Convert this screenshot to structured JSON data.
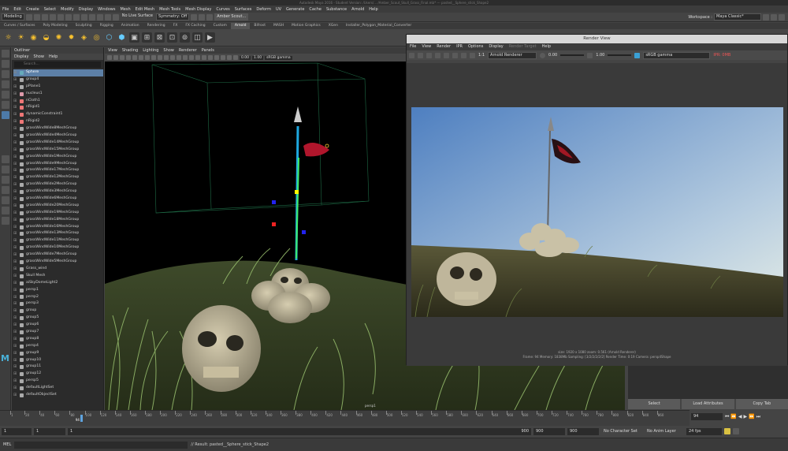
{
  "titlebar": {
    "text": "Autodesk Maya 2016 - Student Version: /Users/... /Amber_Scout_Skull_Grass_Final.mb* --- pasted__Sphere_stick_Shape2"
  },
  "menubar": [
    "File",
    "Edit",
    "Create",
    "Select",
    "Modify",
    "Display",
    "Windows",
    "Mesh",
    "Edit Mesh",
    "Mesh Tools",
    "Mesh Display",
    "Curves",
    "Surfaces",
    "Deform",
    "UV",
    "Generate",
    "Cache",
    "Substance",
    "Arnold",
    "Help"
  ],
  "status": {
    "mode": "Modeling",
    "live": "No Live Surface",
    "symmetry": "Symmetry: Off",
    "user": "Amber Scout...",
    "workspace_label": "Workspace :",
    "workspace": "Maya Classic*"
  },
  "shelf_tabs": [
    "Curves / Surfaces",
    "Poly Modeling",
    "Sculpting",
    "Rigging",
    "Animation",
    "Rendering",
    "FX",
    "FX Caching",
    "Custom",
    "Arnold",
    "Bifrost",
    "MASH",
    "Motion Graphics",
    "XGen",
    "Installer_Polygon_Material_Converter"
  ],
  "shelf_active": "Arnold",
  "outliner": {
    "title": "Outliner",
    "menu": [
      "Display",
      "Show",
      "Help"
    ],
    "search": "Search...",
    "items": [
      {
        "label": "Sphere",
        "selected": true,
        "color": "#6ab"
      },
      {
        "label": "group4",
        "color": "#aaa"
      },
      {
        "label": "pPlane1",
        "color": "#aaa"
      },
      {
        "label": "nucleus1",
        "color": "#d9a"
      },
      {
        "label": "nCloth1",
        "color": "#e77"
      },
      {
        "label": "nRigid1",
        "color": "#e77"
      },
      {
        "label": "dynamicConstraint1",
        "color": "#e77"
      },
      {
        "label": "nRigid2",
        "color": "#e77"
      },
      {
        "label": "grassWindWide8MeshGroup",
        "color": "#aaa"
      },
      {
        "label": "grassWindWide4MeshGroup",
        "color": "#aaa"
      },
      {
        "label": "grassWindWide14MeshGroup",
        "color": "#aaa"
      },
      {
        "label": "grassWindWide15MeshGroup",
        "color": "#aaa"
      },
      {
        "label": "grassWindWide1MeshGroup",
        "color": "#aaa"
      },
      {
        "label": "grassWindWide9MeshGroup",
        "color": "#aaa"
      },
      {
        "label": "grassWindWide17MeshGroup",
        "color": "#aaa"
      },
      {
        "label": "grassWindWide12MeshGroup",
        "color": "#aaa"
      },
      {
        "label": "grassWindWide2MeshGroup",
        "color": "#aaa"
      },
      {
        "label": "grassWindWide3MeshGroup",
        "color": "#aaa"
      },
      {
        "label": "grassWindWide6MeshGroup",
        "color": "#aaa"
      },
      {
        "label": "grassWindWide20MeshGroup",
        "color": "#aaa"
      },
      {
        "label": "grassWindWide19MeshGroup",
        "color": "#aaa"
      },
      {
        "label": "grassWindWide18MeshGroup",
        "color": "#aaa"
      },
      {
        "label": "grassWindWide16MeshGroup",
        "color": "#aaa"
      },
      {
        "label": "grassWindWide13MeshGroup",
        "color": "#aaa"
      },
      {
        "label": "grassWindWide11MeshGroup",
        "color": "#aaa"
      },
      {
        "label": "grassWindWide10MeshGroup",
        "color": "#aaa"
      },
      {
        "label": "grassWindWide7MeshGroup",
        "color": "#aaa"
      },
      {
        "label": "grassWindWide5MeshGroup",
        "color": "#aaa"
      },
      {
        "label": "Grass_wind",
        "color": "#aaa"
      },
      {
        "label": "Skull Mesh",
        "color": "#aaa"
      },
      {
        "label": "aiSkyDomeLight2",
        "color": "#aaa"
      },
      {
        "label": "persp1",
        "color": "#aaa"
      },
      {
        "label": "persp2",
        "color": "#aaa"
      },
      {
        "label": "persp3",
        "color": "#aaa"
      },
      {
        "label": "group",
        "color": "#aaa"
      },
      {
        "label": "group5",
        "color": "#aaa"
      },
      {
        "label": "group6",
        "color": "#aaa"
      },
      {
        "label": "group7",
        "color": "#aaa"
      },
      {
        "label": "group8",
        "color": "#aaa"
      },
      {
        "label": "persp4",
        "color": "#aaa"
      },
      {
        "label": "group9",
        "color": "#aaa"
      },
      {
        "label": "group10",
        "color": "#aaa"
      },
      {
        "label": "group11",
        "color": "#aaa"
      },
      {
        "label": "group12",
        "color": "#aaa"
      },
      {
        "label": "persp5",
        "color": "#aaa"
      },
      {
        "label": "defaultLightSet",
        "color": "#aaa"
      },
      {
        "label": "defaultObjectSet",
        "color": "#aaa"
      }
    ]
  },
  "viewport": {
    "menu": [
      "View",
      "Shading",
      "Lighting",
      "Show",
      "Renderer",
      "Panels"
    ],
    "near": "0.00",
    "far": "1.00",
    "colorspace": "sRGB gamma",
    "camera": "persp1"
  },
  "render_view": {
    "title": "Render View",
    "menu": [
      "File",
      "View",
      "Render",
      "IPR",
      "Options",
      "Display",
      "Render Target",
      "Help"
    ],
    "ratio": "1:1",
    "renderer": "Arnold Renderer",
    "exposure": "0.00",
    "gamma": "1.00",
    "colorspace": "sRGB gamma",
    "ipr": "IPR: 0MB",
    "size_line": "size: 1920 x 1080 zoom: 0.561     (Arnold Renderer)",
    "stats_line": "Frame: 94     Memory: 1838Mb     Sampling: [3/2/2/2/2/2]     Render Time: 0:19     Camera: persp4Shape"
  },
  "attr_buttons": [
    "Select",
    "Load Attributes",
    "Copy Tab"
  ],
  "timeline": {
    "ticks": [
      1,
      20,
      40,
      60,
      80,
      100,
      120,
      140,
      160,
      180,
      200,
      220,
      240,
      260,
      280,
      300,
      320,
      340,
      360,
      380,
      400,
      420,
      440,
      460,
      480,
      500,
      520,
      540,
      560,
      580,
      600,
      620,
      640,
      660,
      680,
      700,
      720,
      740,
      760,
      780,
      800,
      820,
      840,
      860
    ],
    "current": "94",
    "current_frame": 94,
    "end": 900
  },
  "range": {
    "start": "1",
    "start2": "1",
    "playback_start": "1",
    "playback_end": "900",
    "end": "900",
    "end2": "900",
    "char_set": "No Character Set",
    "anim_layer": "No Anim Layer",
    "fps": "24 fps"
  },
  "cmdline": {
    "label": "MEL",
    "result": "// Result: pasted__Sphere_stick_Shape2"
  }
}
